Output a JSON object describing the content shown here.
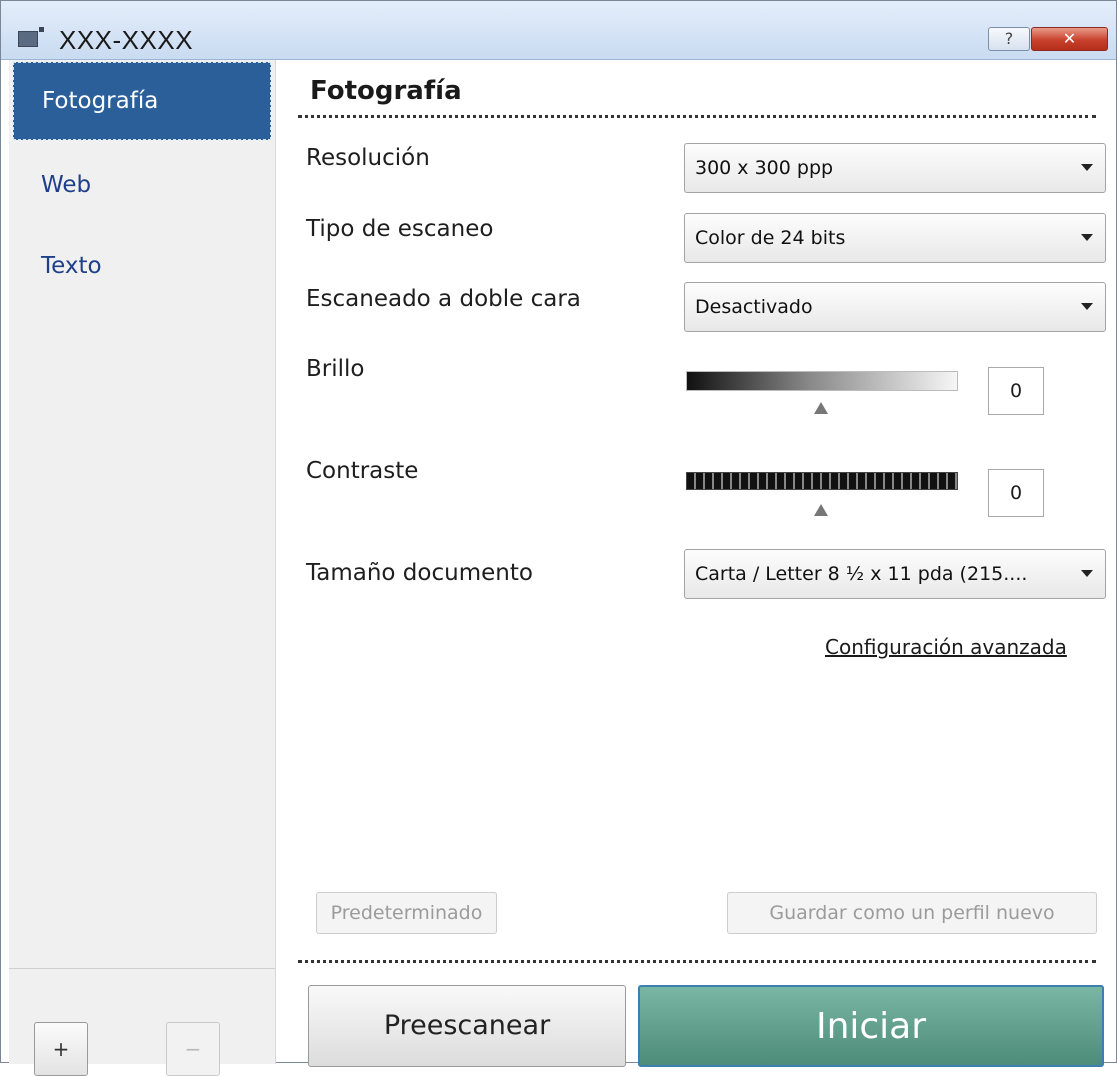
{
  "window": {
    "title": "XXX-XXXX",
    "help_label": "?",
    "close_label": "✕"
  },
  "sidebar": {
    "items": [
      {
        "label": "Fotografía",
        "active": true
      },
      {
        "label": "Web",
        "active": false
      },
      {
        "label": "Texto",
        "active": false
      }
    ],
    "add_label": "+",
    "remove_label": "−"
  },
  "main": {
    "section_title": "Fotografía",
    "resolution": {
      "label": "Resolución",
      "value": "300 x 300 ppp"
    },
    "scan_type": {
      "label": "Tipo de escaneo",
      "value": "Color de 24 bits"
    },
    "duplex": {
      "label": "Escaneado a doble cara",
      "value": "Desactivado"
    },
    "brightness": {
      "label": "Brillo",
      "value": "0"
    },
    "contrast": {
      "label": "Contraste",
      "value": "0"
    },
    "doc_size": {
      "label": "Tamaño documento",
      "value": "Carta / Letter 8 ½ x 11 pda (215...."
    },
    "advanced_link": "Configuración avanzada",
    "default_button": "Predeterminado",
    "save_profile_button": "Guardar como un perfil nuevo",
    "prescan_button": "Preescanear",
    "start_button": "Iniciar"
  }
}
